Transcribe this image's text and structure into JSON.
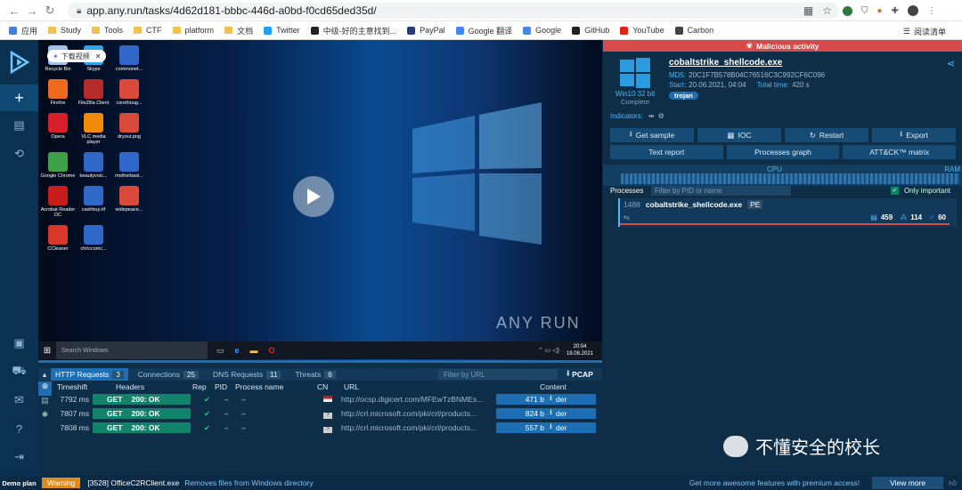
{
  "browser": {
    "url": "app.any.run/tasks/4d62d181-bbbc-446d-a0bd-f0cd65ded35d/",
    "bookmarks": [
      "应用",
      "Study",
      "Tools",
      "CTF",
      "platform",
      "文档",
      "Twitter",
      "中级-好的主意找到...",
      "PayPal",
      "Google 翻译",
      "Google",
      "GitHub",
      "YouTube",
      "Carbon"
    ],
    "reading_list": "阅读清单"
  },
  "desktop": {
    "icons": [
      {
        "label": "Recycle Bin",
        "color": "#9fc3e8"
      },
      {
        "label": "Skype",
        "color": "#2aa7e8"
      },
      {
        "label": "commonet...",
        "color": "#2f68c8"
      },
      {
        "label": "Firefox",
        "color": "#ef6a1c"
      },
      {
        "label": "FileZilla Client",
        "color": "#b52a2a"
      },
      {
        "label": "corethoug...",
        "color": "#d94a3a"
      },
      {
        "label": "Opera",
        "color": "#d71f2c"
      },
      {
        "label": "VLC media player",
        "color": "#f28a0a"
      },
      {
        "label": "dryour.png",
        "color": "#d94a3a"
      },
      {
        "label": "Google Chrome",
        "color": "#3ea046"
      },
      {
        "label": "beautyvoic...",
        "color": "#2f68c8"
      },
      {
        "label": "motherbasi...",
        "color": "#2f68c8"
      },
      {
        "label": "Acrobat Reader DC",
        "color": "#c91d1d"
      },
      {
        "label": "cashbuy.rtf",
        "color": "#2f68c8"
      },
      {
        "label": "widepeace...",
        "color": "#d94a3a"
      },
      {
        "label": "CCleaner",
        "color": "#d9362c"
      },
      {
        "label": "chriccomc...",
        "color": "#2f68c8"
      }
    ],
    "video_chip": "下载视频",
    "watermark": "ANY RUN",
    "taskbar_search": "Search Windows",
    "clock_time": "20:04",
    "clock_date": "19.06.2021"
  },
  "bottom": {
    "tabs": [
      {
        "label": "HTTP Requests",
        "count": "3"
      },
      {
        "label": "Connections",
        "count": "25"
      },
      {
        "label": "DNS Requests",
        "count": "11"
      },
      {
        "label": "Threats",
        "count": "6"
      }
    ],
    "filter_placeholder": "Filter by URL",
    "pcap": "PCAP",
    "headers": [
      "Timeshift",
      "Headers",
      "Rep",
      "PID",
      "Process name",
      "CN",
      "URL",
      "Content"
    ],
    "rows": [
      {
        "time": "7792 ms",
        "req": "GET",
        "status": "200: OK",
        "pid": "–",
        "proc": "–",
        "url": "http://ocsp.digicert.com/MFEwTzBNMEs...",
        "size": "471 b",
        "type": "der"
      },
      {
        "time": "7807 ms",
        "req": "GET",
        "status": "200: OK",
        "pid": "–",
        "proc": "–",
        "url": "http://crl.microsoft.com/pki/crl/products...",
        "size": "824 b",
        "type": "der"
      },
      {
        "time": "7808 ms",
        "req": "GET",
        "status": "200: OK",
        "pid": "–",
        "proc": "–",
        "url": "http://crl.microsoft.com/pki/crl/products...",
        "size": "557 b",
        "type": "der"
      }
    ]
  },
  "panel": {
    "banner": "Malicious activity",
    "file_name": "cobaltstrike_shellcode.exe",
    "md5_label": "MD5:",
    "md5": "20C1F7B578B04C76516C3C992CF6C096",
    "start_label": "Start:",
    "start": "20.06.2021, 04:04",
    "total_label": "Total time:",
    "total": "420 s",
    "os": "Win10 32 bit",
    "os_status": "Complete",
    "tag": "trojan",
    "indicators": "Indicators:",
    "buttons": [
      "Get sample",
      "IOC",
      "Restart",
      "Export"
    ],
    "buttons2": [
      "Text report",
      "Processes graph",
      "ATT&CK™ matrix"
    ],
    "cpu": "CPU",
    "ram": "RAM",
    "processes_label": "Processes",
    "process_filter": "Filter by PID or name",
    "only_important": "Only important",
    "process": {
      "pid": "1488",
      "name": "cobaltstrike_shellcode.exe",
      "type": "PE",
      "files": "459",
      "reg": "114",
      "modules": "60"
    }
  },
  "statusbar": {
    "demo": "Demo plan",
    "warning": "Warning",
    "process": "[3528] OfficeC2RClient.exe",
    "message": "Removes files from Windows directory",
    "promo": "Get more awesome features with premium access!",
    "view_more": "View more"
  },
  "overlay": {
    "wechat": "不懂安全的校长"
  },
  "colors": {
    "accent": "#1c6fb4",
    "malicious": "#d64a4a",
    "teal": "#11836b"
  }
}
